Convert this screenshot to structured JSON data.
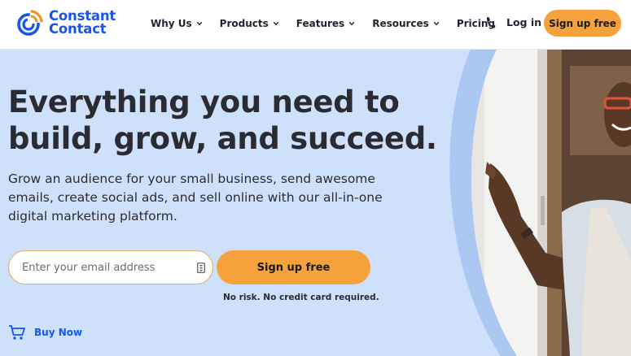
{
  "brand": {
    "name_line1": "Constant",
    "name_line2": "Contact"
  },
  "nav": {
    "items": [
      {
        "label": "Why Us",
        "has_dropdown": true
      },
      {
        "label": "Products",
        "has_dropdown": true
      },
      {
        "label": "Features",
        "has_dropdown": true
      },
      {
        "label": "Resources",
        "has_dropdown": true
      },
      {
        "label": "Pricing",
        "has_dropdown": false
      }
    ],
    "login_label": "Log in",
    "signup_label": "Sign up free"
  },
  "hero": {
    "headline_line1": "Everything you need to",
    "headline_line2": "build, grow, and succeed.",
    "subtext": "Grow an audience for your small business, send awesome emails, create social ads, and sell online with our all-in-one digital marketing platform.",
    "email_placeholder": "Enter your email address",
    "signup_label": "Sign up free",
    "disclaimer": "No risk. No credit card required.",
    "buy_label": "Buy Now"
  },
  "colors": {
    "brand_blue": "#1856ed",
    "accent_orange": "#f6a23c",
    "hero_bg": "#cfe0fb"
  }
}
